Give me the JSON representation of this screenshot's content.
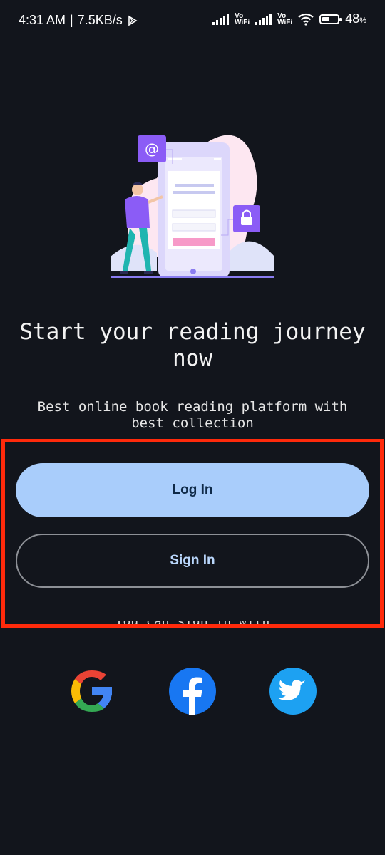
{
  "status_bar": {
    "time": "4:31 AM",
    "separator": "|",
    "speed": "7.5KB/s",
    "vowifi_top": "Vo",
    "vowifi_bottom": "WiFi",
    "battery": "48",
    "battery_suffix": "%",
    "battery_level": 0.48
  },
  "hero": {
    "title": "Start your reading journey now",
    "subtitle": "Best online book reading platform with best collection"
  },
  "actions": {
    "login_label": "Log In",
    "signin_label": "Sign In"
  },
  "alternative": {
    "label": "You can sign in with",
    "providers": [
      "google",
      "facebook",
      "twitter"
    ]
  },
  "colors": {
    "background": "#12151c",
    "primary_button": "#a9cdfb",
    "highlight_border": "#ff2a0b",
    "accent_purple": "#8b5cf6"
  },
  "icons": {
    "notification": "play-store-icon",
    "wifi": "wifi-icon",
    "battery": "battery-icon"
  }
}
